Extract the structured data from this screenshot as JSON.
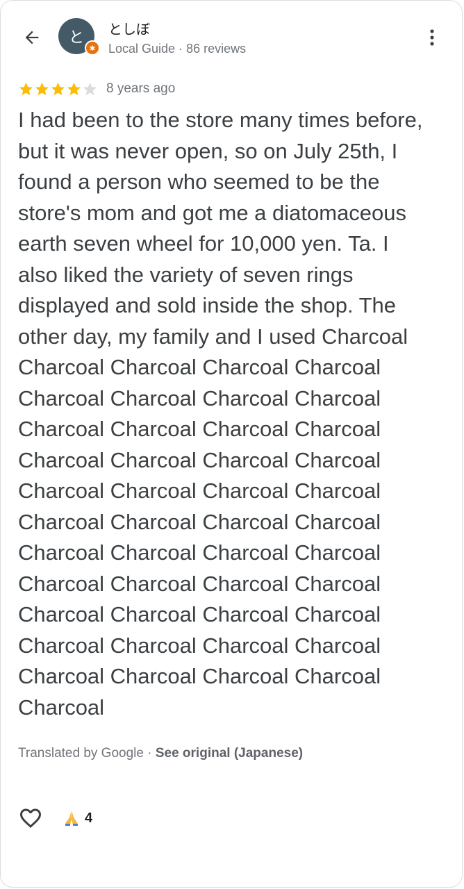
{
  "header": {
    "back_icon": "arrow-left-icon",
    "avatar_letter": "と",
    "user_name": "としぼ",
    "user_meta": "Local Guide · 86 reviews",
    "more_icon": "more-vertical-icon"
  },
  "review": {
    "rating": 4,
    "max_rating": 5,
    "time_ago": "8 years ago",
    "text": "I had been to the store many times before,\nbut it was never open, so on July 25th, I\nfound a person who seemed to be the\nstore's mom and got me a diatomaceous\nearth seven wheel for 10,000 yen. Ta. I\nalso liked the variety of seven rings\ndisplayed and sold inside the shop. The\nother day, my family and I used Charcoal\nCharcoal Charcoal Charcoal Charcoal\nCharcoal Charcoal Charcoal Charcoal\nCharcoal Charcoal Charcoal Charcoal\nCharcoal Charcoal Charcoal Charcoal\nCharcoal Charcoal Charcoal Charcoal\nCharcoal Charcoal Charcoal Charcoal\nCharcoal Charcoal Charcoal Charcoal\nCharcoal Charcoal Charcoal Charcoal\nCharcoal Charcoal Charcoal Charcoal\nCharcoal Charcoal Charcoal Charcoal\nCharcoal Charcoal Charcoal Charcoal\nCharcoal"
  },
  "translation": {
    "label": "Translated by Google · ",
    "link": "See original (Japanese)"
  },
  "actions": {
    "like_icon": "heart-outline-icon",
    "reaction_icon": "praying-hands-icon",
    "reaction_count": "4"
  },
  "colors": {
    "star_filled": "#fbbc04",
    "star_empty": "#dadce0",
    "avatar_bg": "#445a66",
    "badge": "#e8710a"
  }
}
